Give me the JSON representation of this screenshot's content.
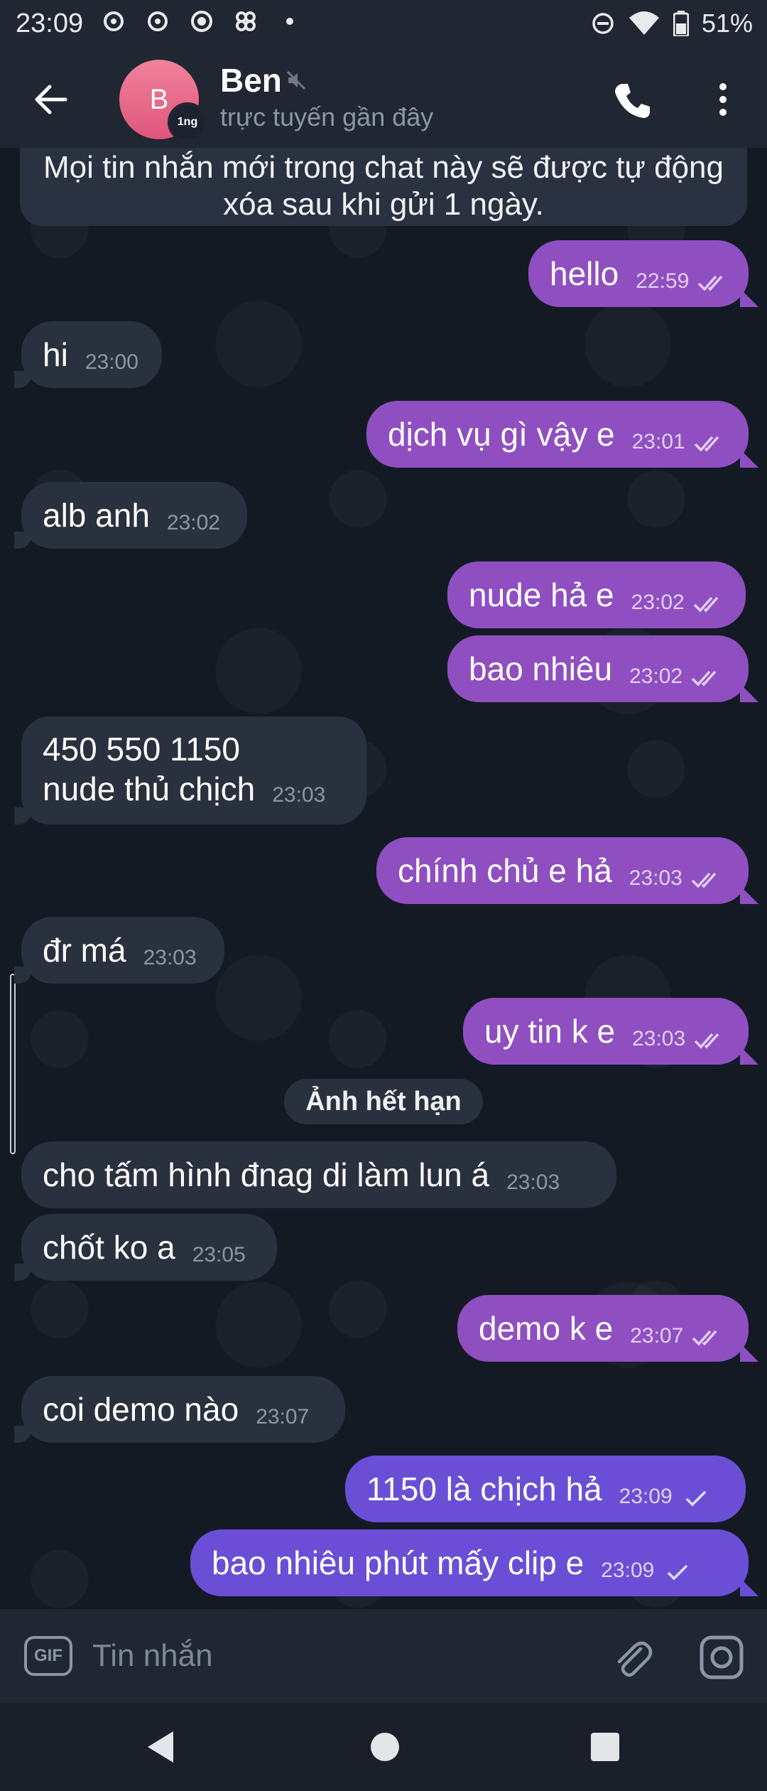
{
  "status_bar": {
    "time": "23:09",
    "battery": "51%"
  },
  "header": {
    "avatar_letter": "B",
    "avatar_badge": "1ng",
    "name": "Ben",
    "status": "trực tuyến gần đây"
  },
  "chat": {
    "notice_line1": "Mọi tin nhắn mới trong chat này sẽ được tự động",
    "notice_line2": "xóa sau khi gửi 1 ngày.",
    "messages": [
      {
        "dir": "out",
        "text": "hello",
        "time": "22:59",
        "status": "read"
      },
      {
        "dir": "in",
        "text": "hi",
        "time": "23:00"
      },
      {
        "dir": "out",
        "text": "dịch vụ gì vậy e",
        "time": "23:01",
        "status": "read"
      },
      {
        "dir": "in",
        "text": "alb anh",
        "time": "23:02"
      },
      {
        "dir": "out",
        "text": "nude hả e",
        "time": "23:02",
        "status": "read"
      },
      {
        "dir": "out",
        "text": "bao nhiêu",
        "time": "23:02",
        "status": "read"
      },
      {
        "dir": "in",
        "line1": "450 550 1150",
        "line2": "nude thủ chịch",
        "time": "23:03"
      },
      {
        "dir": "out",
        "text": "chính chủ e hả",
        "time": "23:03",
        "status": "read"
      },
      {
        "dir": "in",
        "text": "đr má",
        "time": "23:03"
      },
      {
        "dir": "out",
        "text": "uy tin k e",
        "time": "23:03",
        "status": "read"
      },
      {
        "dir": "in",
        "text": "cho tấm hình đnag di làm lun á",
        "time": "23:03"
      },
      {
        "dir": "in",
        "text": "chốt ko a",
        "time": "23:05"
      },
      {
        "dir": "out",
        "text": "demo k e",
        "time": "23:07",
        "status": "read"
      },
      {
        "dir": "in",
        "text": "coi demo nào",
        "time": "23:07"
      },
      {
        "dir": "out",
        "text": "1150 là chịch hả",
        "time": "23:09",
        "status": "sent"
      },
      {
        "dir": "out",
        "text": "bao nhiêu phút mấy clip e",
        "time": "23:09",
        "status": "sent"
      }
    ],
    "expired_photo_label": "Ảnh hết hạn"
  },
  "composer": {
    "gif_label": "GIF",
    "placeholder": "Tin nhắn"
  },
  "colors": {
    "outgoing_bubble": "#8f4fc1",
    "outgoing_bubble_latest": "#6a4fd6",
    "incoming_bubble": "#2a313e",
    "header_bg": "#202632"
  }
}
